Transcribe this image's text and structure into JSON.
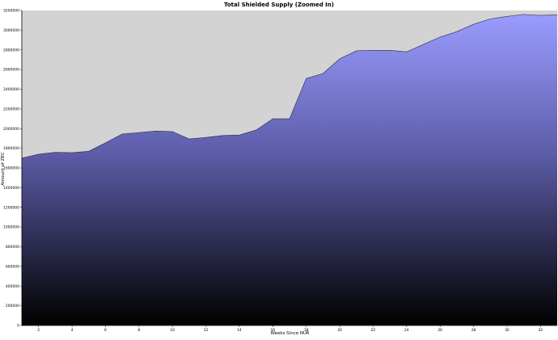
{
  "chart_data": {
    "type": "area",
    "title": "Total Shielded Supply (Zoomed In)",
    "xlabel": "Weeks Since NU6",
    "ylabel": "Amount of ZEC",
    "xlim": [
      1,
      33
    ],
    "ylim": [
      0,
      3200000
    ],
    "x_ticks": [
      "2",
      "4",
      "6",
      "8",
      "10",
      "12",
      "14",
      "16",
      "18",
      "20",
      "22",
      "24",
      "26",
      "28",
      "30",
      "32"
    ],
    "y_ticks": [
      "0",
      "200000",
      "400000",
      "600000",
      "800000",
      "1000000",
      "1200000",
      "1400000",
      "1600000",
      "1800000",
      "2000000",
      "2200000",
      "2400000",
      "2600000",
      "2800000",
      "3000000",
      "3200000"
    ],
    "grid": false,
    "plot_background": "#d3d3d3",
    "fill_gradient": {
      "top": "#9a9cff",
      "bottom": "#000000"
    },
    "x": [
      1,
      2,
      3,
      4,
      5,
      6,
      7,
      8,
      9,
      10,
      11,
      12,
      13,
      14,
      15,
      16,
      17,
      18,
      19,
      20,
      21,
      22,
      23,
      24,
      25,
      26,
      27,
      28,
      29,
      30,
      31,
      32,
      33
    ],
    "series": [
      {
        "values": [
          1700000,
          1740000,
          1760000,
          1755000,
          1770000,
          1855000,
          1945000,
          1960000,
          1975000,
          1970000,
          1895000,
          1910000,
          1930000,
          1935000,
          1985000,
          2100000,
          2100000,
          2510000,
          2560000,
          2710000,
          2790000,
          2795000,
          2795000,
          2780000,
          2855000,
          2930000,
          2985000,
          3060000,
          3115000,
          3140000,
          3160000,
          3150000,
          3155000
        ]
      }
    ]
  }
}
